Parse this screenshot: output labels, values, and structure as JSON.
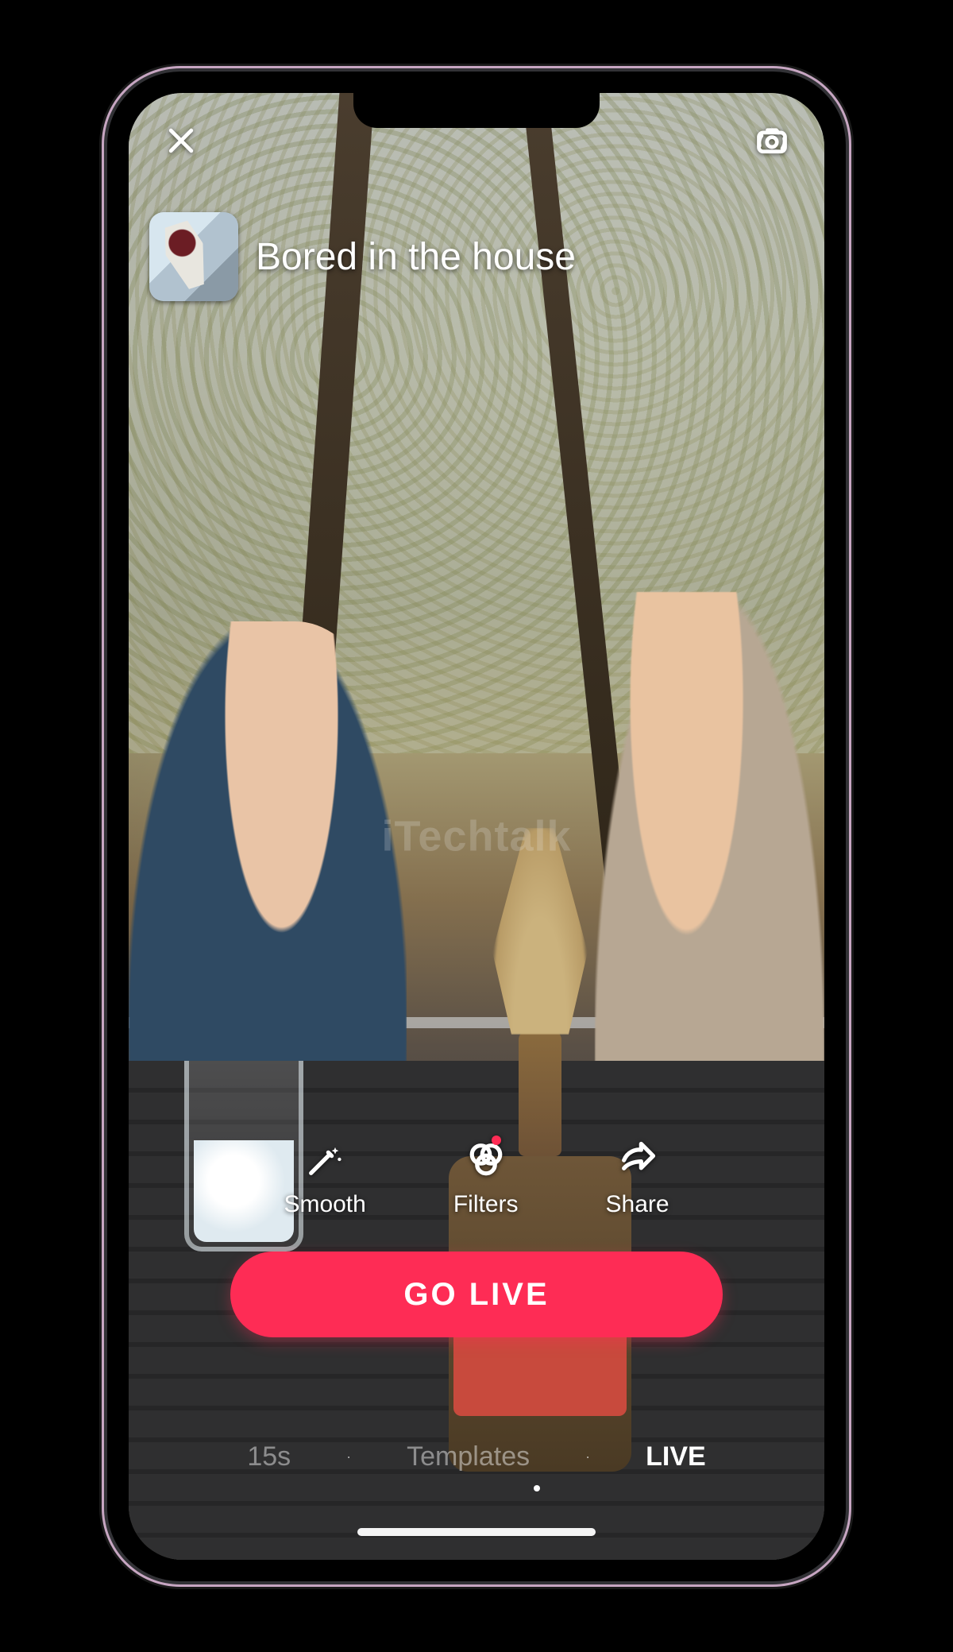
{
  "header": {
    "close_label": "Close",
    "flip_label": "Flip camera"
  },
  "live": {
    "title": "Bored in the house",
    "cover_alt": "Live cover thumbnail"
  },
  "watermark": "iTechtalk",
  "tools": {
    "smooth": "Smooth",
    "filters": "Filters",
    "share": "Share",
    "filters_has_badge": true
  },
  "cta": {
    "go_live": "GO LIVE"
  },
  "modes": {
    "items": [
      "15s",
      "Templates",
      "LIVE"
    ],
    "active_index": 2
  }
}
